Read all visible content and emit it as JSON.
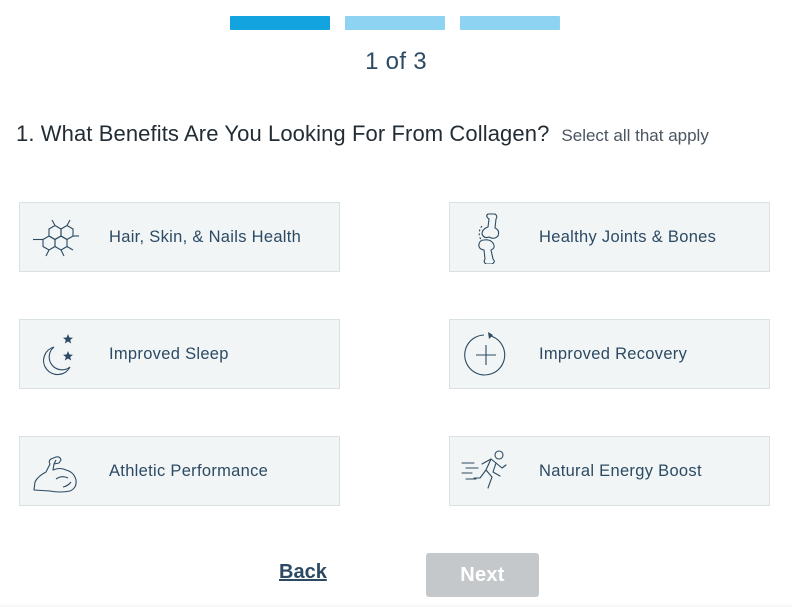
{
  "progress": {
    "steps": [
      "active",
      "inactive",
      "inactive"
    ],
    "counter": "1 of 3"
  },
  "question": {
    "title": "1. What Benefits Are You Looking For From Collagen?",
    "hint": "Select all that apply"
  },
  "options": [
    {
      "label": "Hair, Skin, & Nails Health",
      "icon": "molecule-icon"
    },
    {
      "label": "Healthy Joints & Bones",
      "icon": "bone-joint-icon"
    },
    {
      "label": "Improved Sleep",
      "icon": "moon-stars-icon"
    },
    {
      "label": "Improved Recovery",
      "icon": "recovery-plus-icon"
    },
    {
      "label": "Athletic Performance",
      "icon": "flexed-arm-icon"
    },
    {
      "label": "Natural Energy Boost",
      "icon": "running-person-icon"
    }
  ],
  "nav": {
    "back_label": "Back",
    "next_label": "Next"
  },
  "colors": {
    "progress_active": "#13a3de",
    "progress_inactive": "#8ed4f2",
    "text_primary": "#2c4a64",
    "card_bg": "#f1f5f5",
    "next_disabled": "#c4c8cb"
  }
}
